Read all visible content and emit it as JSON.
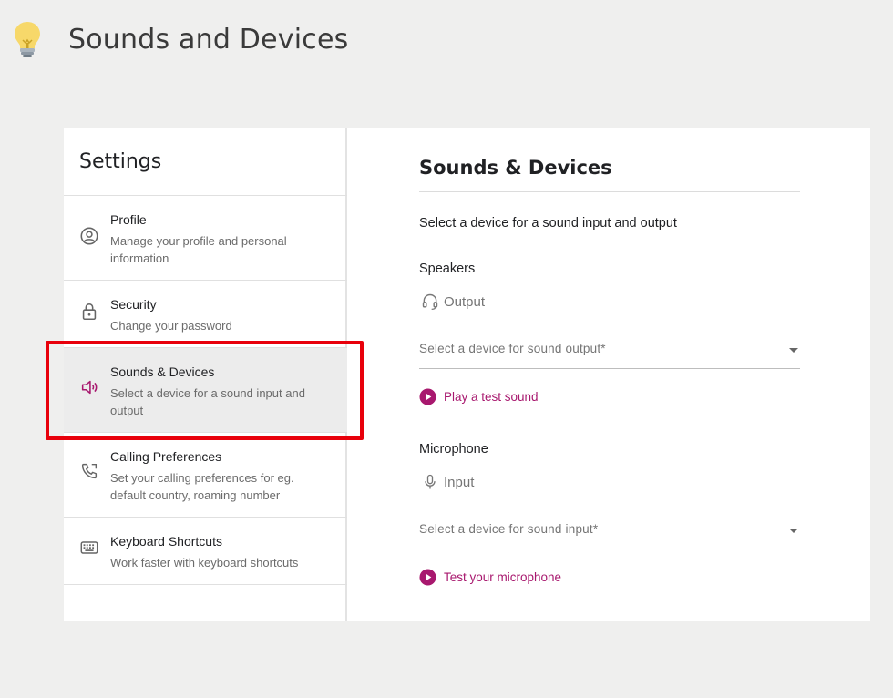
{
  "page": {
    "title": "Sounds and Devices"
  },
  "sidebar": {
    "title": "Settings",
    "items": [
      {
        "label": "Profile",
        "description": "Manage your profile and personal information",
        "icon": "profile-icon"
      },
      {
        "label": "Security",
        "description": "Change your password",
        "icon": "lock-icon"
      },
      {
        "label": "Sounds & Devices",
        "description": "Select a device for a sound input and output",
        "icon": "speaker-icon",
        "active": true
      },
      {
        "label": "Calling Preferences",
        "description": "Set your calling preferences for eg. default country, roaming number",
        "icon": "phone-icon"
      },
      {
        "label": "Keyboard Shortcuts",
        "description": "Work faster with keyboard shortcuts",
        "icon": "keyboard-icon"
      }
    ]
  },
  "content": {
    "title": "Sounds & Devices",
    "subtitle": "Select a device for a sound input and output",
    "speakers": {
      "title": "Speakers",
      "type_label": "Output",
      "select_placeholder": "Select a device for sound output*",
      "action_label": "Play a test sound"
    },
    "microphone": {
      "title": "Microphone",
      "type_label": "Input",
      "select_placeholder": "Select a device for sound input*",
      "action_label": "Test your microphone"
    }
  },
  "colors": {
    "accent": "#a8186e",
    "highlight": "#e8000b",
    "background": "#efefee"
  }
}
